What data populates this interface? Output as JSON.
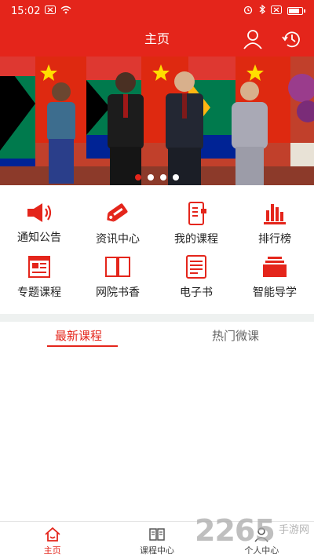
{
  "status_bar": {
    "time": "15:02",
    "battery_level": 0.85
  },
  "header": {
    "title": "主页"
  },
  "banner": {
    "slide_count": 4,
    "active_slide": 1
  },
  "menu": [
    {
      "label": "通知公告",
      "icon": "megaphone-icon"
    },
    {
      "label": "资讯中心",
      "icon": "tag-icon"
    },
    {
      "label": "我的课程",
      "icon": "notebook-icon"
    },
    {
      "label": "排行榜",
      "icon": "bar-chart-icon"
    },
    {
      "label": "专题课程",
      "icon": "article-icon"
    },
    {
      "label": "网院书香",
      "icon": "open-book-icon"
    },
    {
      "label": "电子书",
      "icon": "ebook-icon"
    },
    {
      "label": "智能导学",
      "icon": "stack-icon"
    }
  ],
  "tabs": [
    {
      "label": "最新课程",
      "active": true
    },
    {
      "label": "热门微课",
      "active": false
    }
  ],
  "bottom_nav": [
    {
      "label": "主页",
      "icon": "home-icon",
      "active": true
    },
    {
      "label": "课程中心",
      "icon": "book-icon",
      "active": false
    },
    {
      "label": "个人中心",
      "icon": "person-icon",
      "active": false
    }
  ],
  "watermark": {
    "number": "2265",
    "suffix": "手游网"
  },
  "colors": {
    "brand_red": "#e4251b",
    "divider": "#eef1f0"
  }
}
